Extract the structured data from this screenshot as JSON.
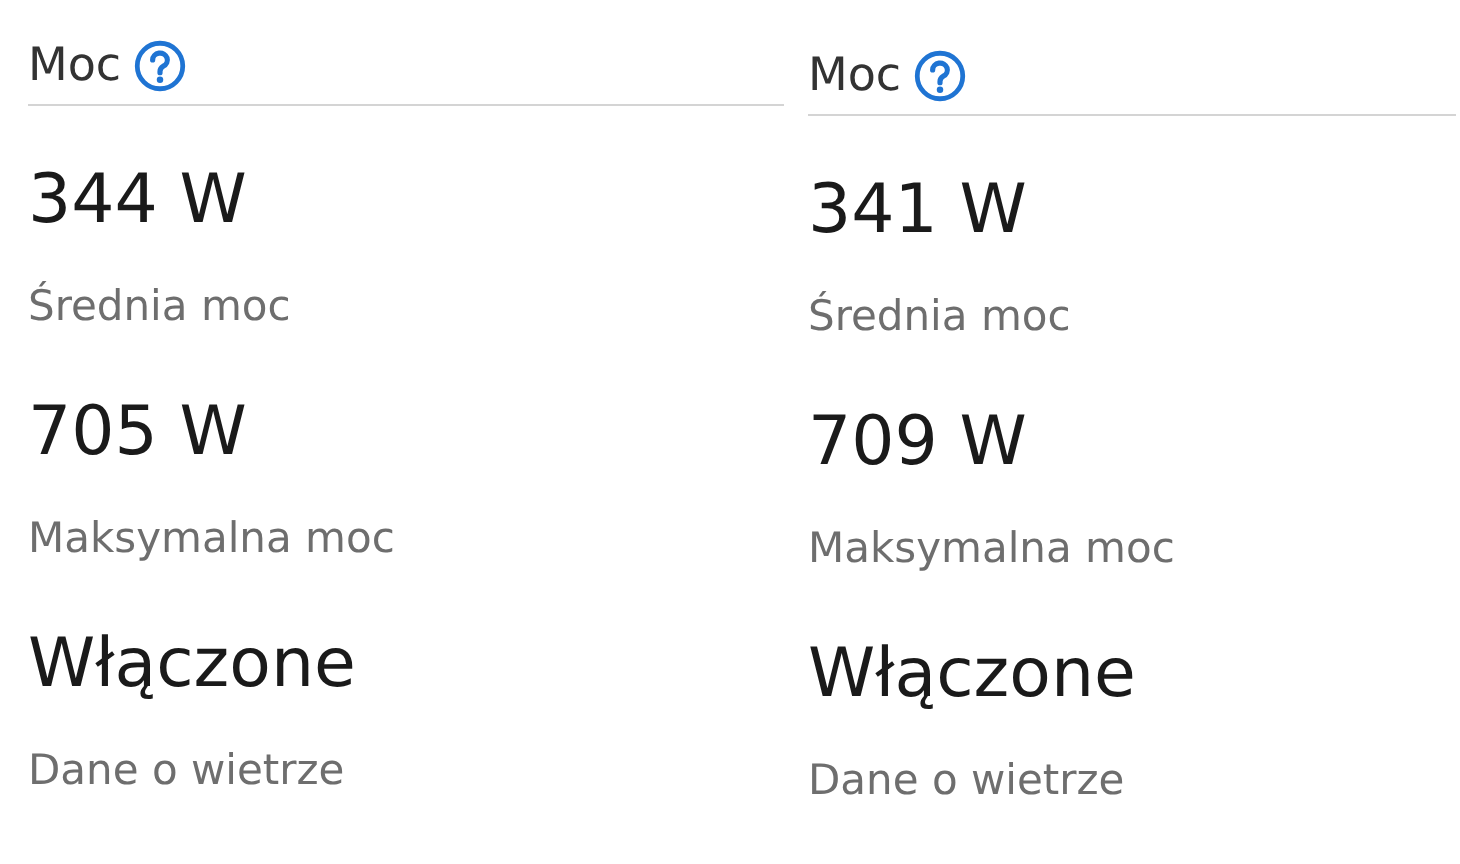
{
  "panels": [
    {
      "title": "Moc",
      "stats": [
        {
          "value": "344 W",
          "label": "Średnia moc"
        },
        {
          "value": "705 W",
          "label": "Maksymalna moc"
        },
        {
          "value": "Włączone",
          "label": "Dane o wietrze"
        }
      ]
    },
    {
      "title": "Moc",
      "stats": [
        {
          "value": "341 W",
          "label": "Średnia moc"
        },
        {
          "value": "709 W",
          "label": "Maksymalna moc"
        },
        {
          "value": "Włączone",
          "label": "Dane o wietrze"
        }
      ]
    }
  ]
}
